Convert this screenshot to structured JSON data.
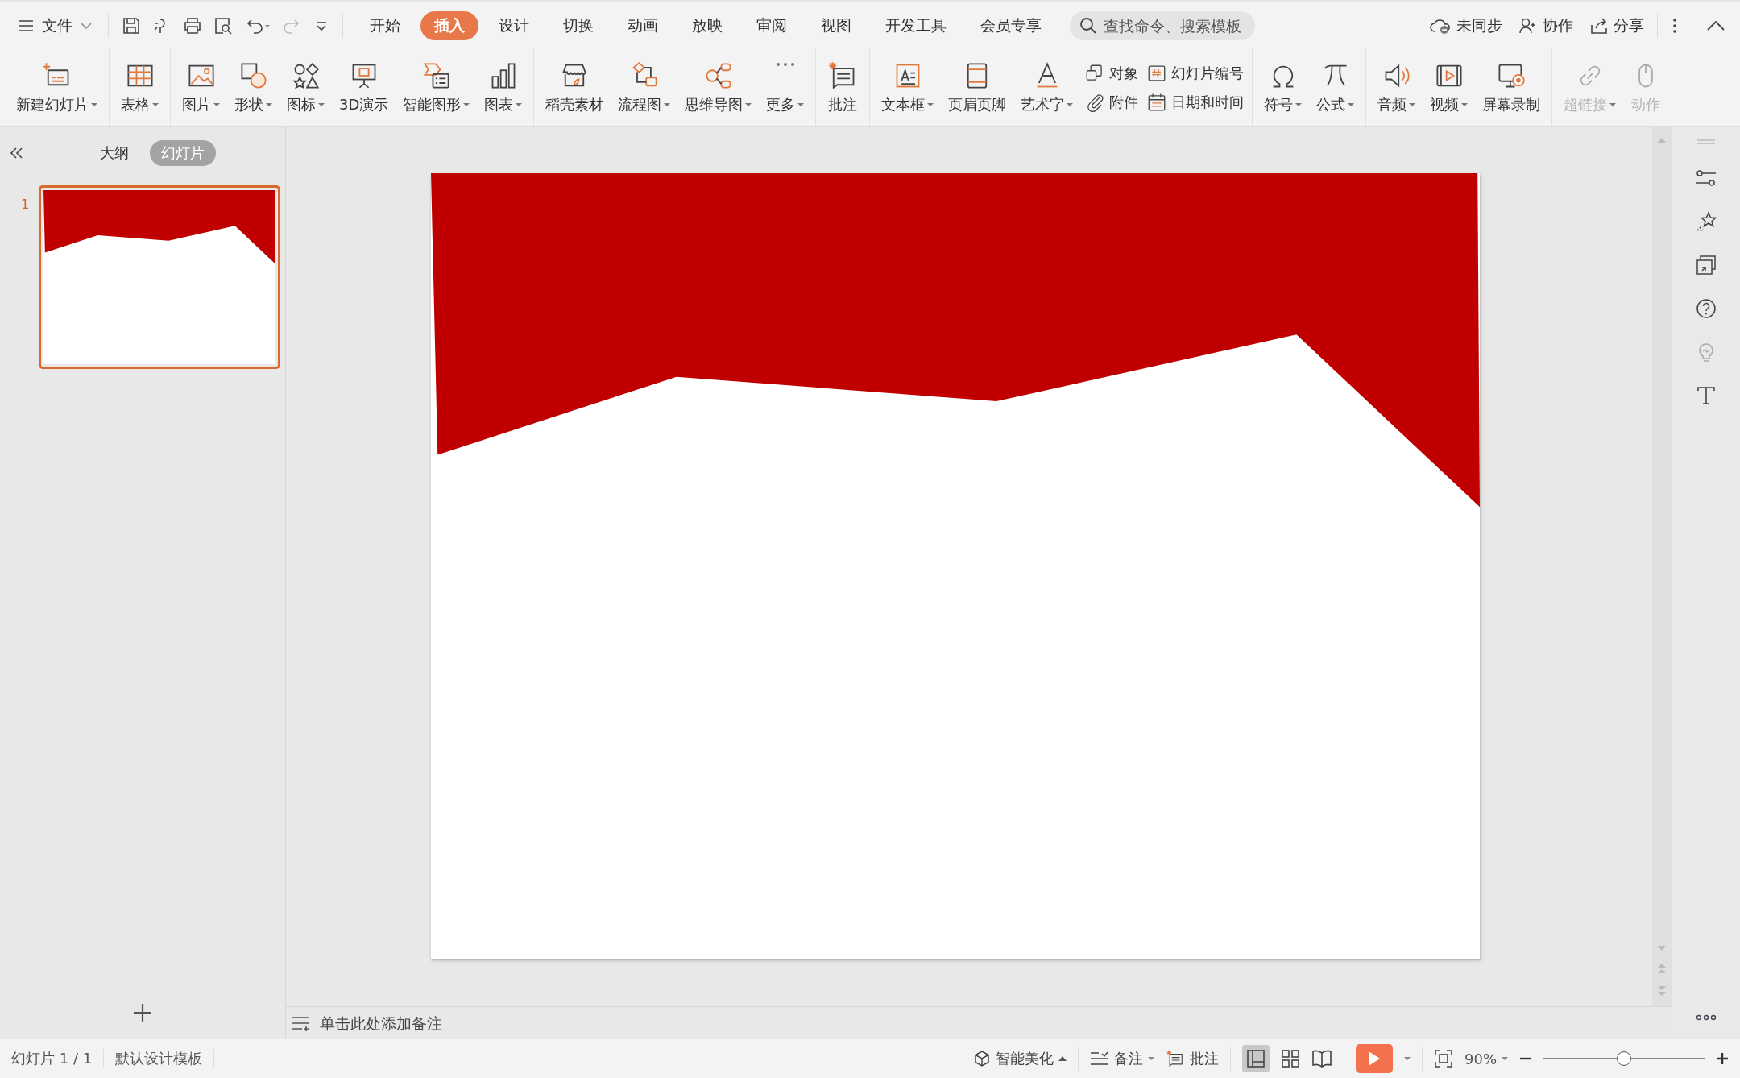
{
  "menu": {
    "file": "文件",
    "tabs": [
      {
        "label": "开始",
        "selected": false
      },
      {
        "label": "插入",
        "selected": true
      },
      {
        "label": "设计",
        "selected": false
      },
      {
        "label": "切换",
        "selected": false
      },
      {
        "label": "动画",
        "selected": false
      },
      {
        "label": "放映",
        "selected": false
      },
      {
        "label": "审阅",
        "selected": false
      },
      {
        "label": "视图",
        "selected": false
      },
      {
        "label": "开发工具",
        "selected": false
      },
      {
        "label": "会员专享",
        "selected": false
      }
    ],
    "search": {
      "placeholder": "查找命令、搜索模板"
    },
    "actions": [
      "未同步",
      "协作",
      "分享"
    ]
  },
  "ribbon": [
    {
      "items": [
        {
          "kind": "large",
          "label": "新建幻灯片",
          "dropdown": true,
          "disabled": false
        }
      ]
    },
    {
      "items": [
        {
          "kind": "large",
          "label": "表格",
          "dropdown": true,
          "disabled": false
        }
      ]
    },
    {
      "items": [
        {
          "kind": "large",
          "label": "图片",
          "dropdown": true,
          "disabled": false
        },
        {
          "kind": "large",
          "label": "形状",
          "dropdown": true,
          "disabled": false
        },
        {
          "kind": "large",
          "label": "图标",
          "dropdown": true,
          "disabled": false
        },
        {
          "kind": "large",
          "label": "3D演示",
          "dropdown": false,
          "disabled": false
        },
        {
          "kind": "large",
          "label": "智能图形",
          "dropdown": true,
          "disabled": false
        },
        {
          "kind": "large",
          "label": "图表",
          "dropdown": true,
          "disabled": false
        }
      ]
    },
    {
      "items": [
        {
          "kind": "large",
          "label": "稻壳素材",
          "dropdown": false,
          "disabled": false
        },
        {
          "kind": "large",
          "label": "流程图",
          "dropdown": true,
          "disabled": false
        },
        {
          "kind": "large",
          "label": "思维导图",
          "dropdown": true,
          "disabled": false
        },
        {
          "kind": "large",
          "label": "更多",
          "dropdown": true,
          "disabled": false
        }
      ]
    },
    {
      "items": [
        {
          "kind": "large",
          "label": "批注",
          "dropdown": false,
          "disabled": false
        }
      ]
    },
    {
      "items": [
        {
          "kind": "large",
          "label": "文本框",
          "dropdown": true,
          "disabled": false
        },
        {
          "kind": "large",
          "label": "页眉页脚",
          "dropdown": false,
          "disabled": false
        },
        {
          "kind": "large",
          "label": "艺术字",
          "dropdown": true,
          "disabled": false
        },
        {
          "kind": "stack",
          "items": [
            {
              "label": "对象"
            },
            {
              "label": "附件"
            }
          ]
        },
        {
          "kind": "stack",
          "items": [
            {
              "label": "幻灯片编号"
            },
            {
              "label": "日期和时间"
            }
          ]
        }
      ]
    },
    {
      "items": [
        {
          "kind": "large",
          "label": "符号",
          "dropdown": true,
          "disabled": false
        },
        {
          "kind": "large",
          "label": "公式",
          "dropdown": true,
          "disabled": false
        }
      ]
    },
    {
      "items": [
        {
          "kind": "large",
          "label": "音频",
          "dropdown": true,
          "disabled": false
        },
        {
          "kind": "large",
          "label": "视频",
          "dropdown": true,
          "disabled": false
        },
        {
          "kind": "large",
          "label": "屏幕录制",
          "dropdown": false,
          "disabled": false
        }
      ]
    },
    {
      "items": [
        {
          "kind": "large",
          "label": "超链接",
          "dropdown": true,
          "disabled": true
        },
        {
          "kind": "large",
          "label": "动作",
          "dropdown": false,
          "disabled": true
        }
      ]
    }
  ],
  "panel": {
    "tabs": [
      {
        "label": "大纲",
        "selected": false
      },
      {
        "label": "幻灯片",
        "selected": true
      }
    ],
    "slides": [
      {
        "number": "1",
        "selected": true
      }
    ]
  },
  "notes": {
    "placeholder": "单击此处添加备注"
  },
  "status_bar": {
    "slide": "幻灯片 1 / 1",
    "template": "默认设计模板",
    "beautify": "智能美化",
    "notes": "备注",
    "comments": "批注",
    "zoom": "90%",
    "zoom_slider": {
      "level": 0.5
    }
  }
}
